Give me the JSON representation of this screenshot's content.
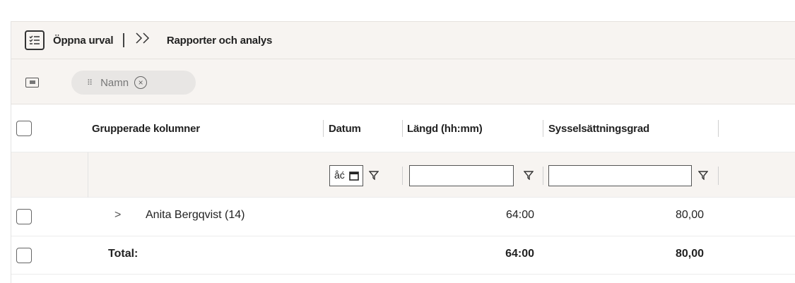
{
  "toolbar": {
    "open_label": "Öppna urval",
    "breadcrumb_chevron": "»",
    "report_label": "Rapporter och analys",
    "list_icon": "checklist-icon"
  },
  "group_bar": {
    "toggle_icon": "group-panel-icon",
    "chip": {
      "grip": "⠿",
      "label": "Namn",
      "close_icon": "close-circle-icon"
    }
  },
  "columns": [
    {
      "label": "Grupperade kolumner"
    },
    {
      "label": "Datum"
    },
    {
      "label": "Längd (hh:mm)"
    },
    {
      "label": "Sysselsättningsgrad"
    }
  ],
  "filters": {
    "date_input_glyph": "åć",
    "date_icon": "calendar-icon",
    "filter_icon": "funnel-icon"
  },
  "rows": [
    {
      "expander": ">",
      "name": "Anita Bergqvist (14)",
      "length": "64:00",
      "rate": "80,00"
    }
  ],
  "total": {
    "label": "Total:",
    "length": "64:00",
    "rate": "80,00"
  },
  "colors": {
    "toolbar_bg": "#f7f4f1",
    "chip_bg": "#e8e6e4",
    "border": "#e6e2de"
  }
}
